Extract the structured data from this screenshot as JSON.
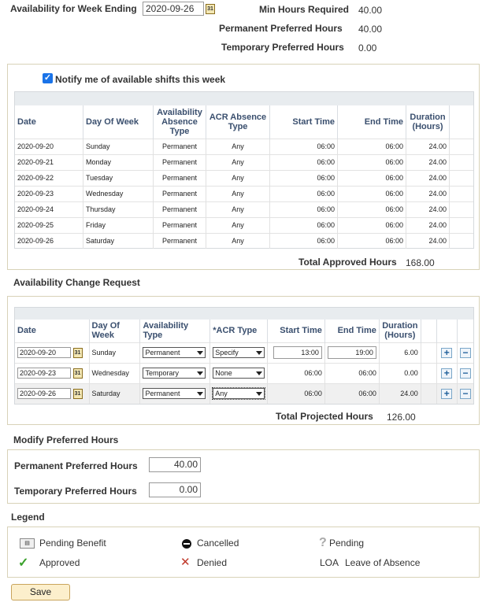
{
  "header": {
    "week_ending_label": "Availability for Week Ending",
    "week_ending_value": "2020-09-26",
    "min_hours_label": "Min Hours Required",
    "min_hours_value": "40.00",
    "perm_pref_label": "Permanent Preferred Hours",
    "perm_pref_value": "40.00",
    "temp_pref_label": "Temporary Preferred Hours",
    "temp_pref_value": "0.00"
  },
  "availability": {
    "notify_label": "Notify me of available shifts this week",
    "notify_checked": true,
    "columns": [
      "Date",
      "Day Of Week",
      "Availability Absence Type",
      "ACR Absence Type",
      "Start Time",
      "End Time",
      "Duration (Hours)"
    ],
    "rows": [
      [
        "2020-09-20",
        "Sunday",
        "Permanent",
        "Any",
        "06:00",
        "06:00",
        "24.00"
      ],
      [
        "2020-09-21",
        "Monday",
        "Permanent",
        "Any",
        "06:00",
        "06:00",
        "24.00"
      ],
      [
        "2020-09-22",
        "Tuesday",
        "Permanent",
        "Any",
        "06:00",
        "06:00",
        "24.00"
      ],
      [
        "2020-09-23",
        "Wednesday",
        "Permanent",
        "Any",
        "06:00",
        "06:00",
        "24.00"
      ],
      [
        "2020-09-24",
        "Thursday",
        "Permanent",
        "Any",
        "06:00",
        "06:00",
        "24.00"
      ],
      [
        "2020-09-25",
        "Friday",
        "Permanent",
        "Any",
        "06:00",
        "06:00",
        "24.00"
      ],
      [
        "2020-09-26",
        "Saturday",
        "Permanent",
        "Any",
        "06:00",
        "06:00",
        "24.00"
      ]
    ],
    "total_label": "Total Approved Hours",
    "total_value": "168.00"
  },
  "change_request": {
    "title": "Availability Change Request",
    "columns": [
      "Date",
      "Day Of Week",
      "Availability Type",
      "*ACR Type",
      "Start Time",
      "End Time",
      "Duration (Hours)"
    ],
    "rows": [
      {
        "date": "2020-09-20",
        "day": "Sunday",
        "avail_type": "Permanent",
        "acr_type": "Specify",
        "start": "13:00",
        "end": "19:00",
        "duration": "6.00"
      },
      {
        "date": "2020-09-23",
        "day": "Wednesday",
        "avail_type": "Temporary",
        "acr_type": "None",
        "start": "06:00",
        "end": "06:00",
        "duration": "0.00"
      },
      {
        "date": "2020-09-26",
        "day": "Saturday",
        "avail_type": "Permanent",
        "acr_type": "Any",
        "start": "06:00",
        "end": "06:00",
        "duration": "24.00"
      }
    ],
    "total_label": "Total Projected Hours",
    "total_value": "126.00"
  },
  "modify": {
    "title": "Modify Preferred Hours",
    "perm_label": "Permanent Preferred Hours",
    "perm_value": "40.00",
    "temp_label": "Temporary Preferred Hours",
    "temp_value": "0.00"
  },
  "legend": {
    "title": "Legend",
    "pending_benefit": "Pending Benefit",
    "cancelled": "Cancelled",
    "pending": "Pending",
    "approved": "Approved",
    "denied": "Denied",
    "loa_abbr": "LOA",
    "loa_text": "Leave of Absence"
  },
  "save_label": "Save",
  "icons": {
    "calendar": "calendar-icon",
    "add": "plus-icon",
    "remove": "minus-icon",
    "approved": "checkmark-icon",
    "denied": "x-icon",
    "cancelled": "cancelled-icon",
    "pending": "question-icon",
    "pending_benefit": "pending-benefit-icon"
  },
  "colors": {
    "header_text": "#3a4f6e",
    "approved": "#3aa12c",
    "denied": "#c0392b",
    "button_bg": "#fcefcc"
  }
}
